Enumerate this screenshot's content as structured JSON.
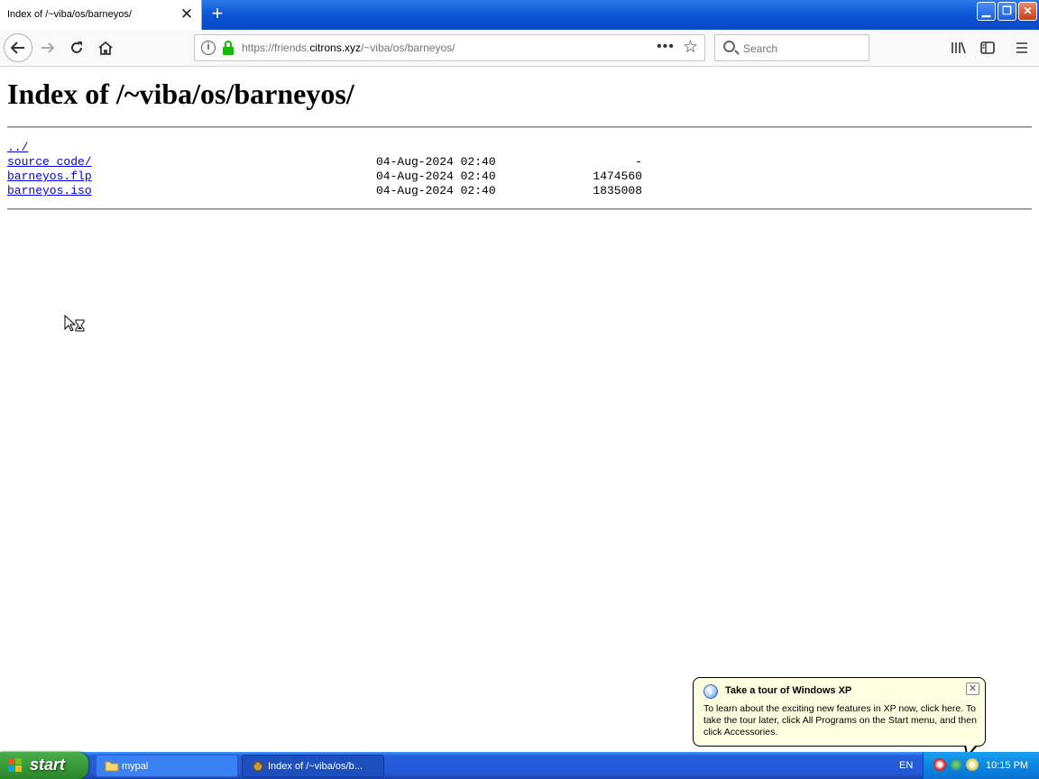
{
  "window": {
    "tab_title": "Index of /~viba/os/barneyos/",
    "tab_close": "✕",
    "new_tab": "+",
    "controls": {
      "minimize": "▁",
      "maximize": "❐",
      "close": "✕"
    }
  },
  "navbar": {
    "url_prefix": "https://friends.",
    "url_domain": "citrons.xyz",
    "url_path": "/~viba/os/barneyos/",
    "search_placeholder": "Search",
    "icons": [
      "back-arrow-icon",
      "forward-arrow-icon",
      "reload-icon",
      "home-icon",
      "info-icon",
      "lock-icon",
      "page-actions-icon",
      "bookmark-star-icon",
      "search-icon",
      "library-icon",
      "sidebar-icon",
      "menu-icon"
    ]
  },
  "page": {
    "heading": "Index of /~viba/os/barneyos/",
    "entries": [
      {
        "name": "../",
        "date": "",
        "size": ""
      },
      {
        "name": "source code/",
        "date": "04-Aug-2024 02:40",
        "size": "-"
      },
      {
        "name": "barneyos.flp",
        "date": "04-Aug-2024 02:40",
        "size": "1474560"
      },
      {
        "name": "barneyos.iso",
        "date": "04-Aug-2024 02:40",
        "size": "1835008"
      }
    ]
  },
  "balloon": {
    "title": "Take a tour of Windows XP",
    "text": "To learn about the exciting new features in XP now, click here. To take the tour later, click All Programs on the Start menu, and then click Accessories.",
    "close": "✕"
  },
  "taskbar": {
    "start_label": "start",
    "tasks": [
      {
        "label": "mypal"
      },
      {
        "label": "Index of /~viba/os/b..."
      }
    ],
    "language": "EN",
    "clock": "10:15 PM"
  },
  "colors": {
    "link": "#0000ee",
    "xp_blue": "#245edb",
    "start_green": "#379a37",
    "balloon_bg": "#ffffe1",
    "lock_green": "#12bc00"
  }
}
